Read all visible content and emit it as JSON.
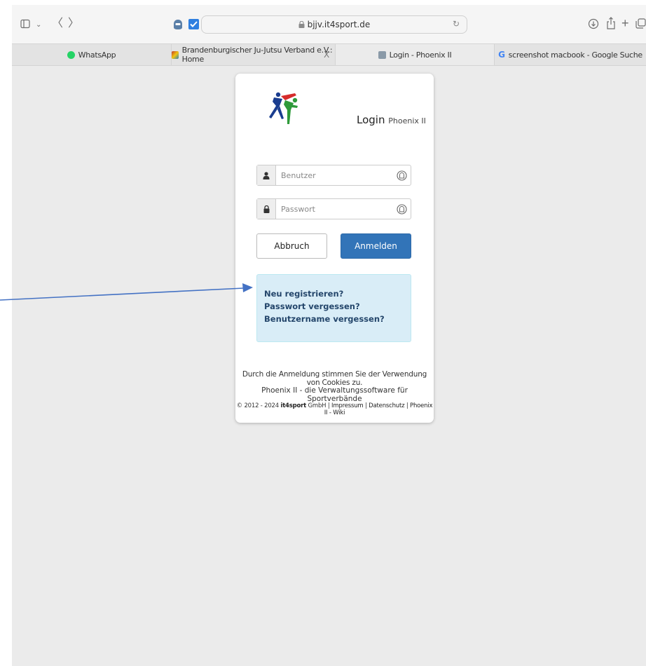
{
  "browser": {
    "url": "bjjv.it4sport.de",
    "tabs": [
      {
        "label": "WhatsApp",
        "favicon_color": "#25d366"
      },
      {
        "label": "Brandenburgischer Ju-Jutsu Verband e.V.: Home",
        "favicon_color": "#c0392b"
      },
      {
        "label": "Login - Phoenix II",
        "favicon_color": "#7f8c8d",
        "active": true
      },
      {
        "label": "screenshot macbook - Google Suche",
        "favicon_color": "#4285f4"
      }
    ],
    "tab_close": "X"
  },
  "login": {
    "title": "Login",
    "subtitle": "Phoenix II",
    "username_placeholder": "Benutzer",
    "password_placeholder": "Passwort",
    "cancel_label": "Abbruch",
    "submit_label": "Anmelden"
  },
  "links": {
    "register": "Neu registrieren?",
    "forgot_password": "Passwort vergessen?",
    "forgot_username": "Benutzername vergessen?"
  },
  "footer": {
    "cookie_notice": "Durch die Anmeldung stimmen Sie der Verwendung von Cookies zu.",
    "tagline": "Phoenix II - die Verwaltungssoftware für Sportverbände",
    "copyright_prefix": "© 2012 - 2024 ",
    "company": "it4sport",
    "company_suffix": " GmbH | ",
    "impressum": "Impressum",
    "sep1": " | ",
    "datenschutz": "Datenschutz",
    "sep2": " | ",
    "wiki": "Phoenix II - Wiki"
  },
  "colors": {
    "primary": "#3274b8",
    "info_bg": "#d9edf7",
    "annotation_arrow": "#4472c4"
  }
}
